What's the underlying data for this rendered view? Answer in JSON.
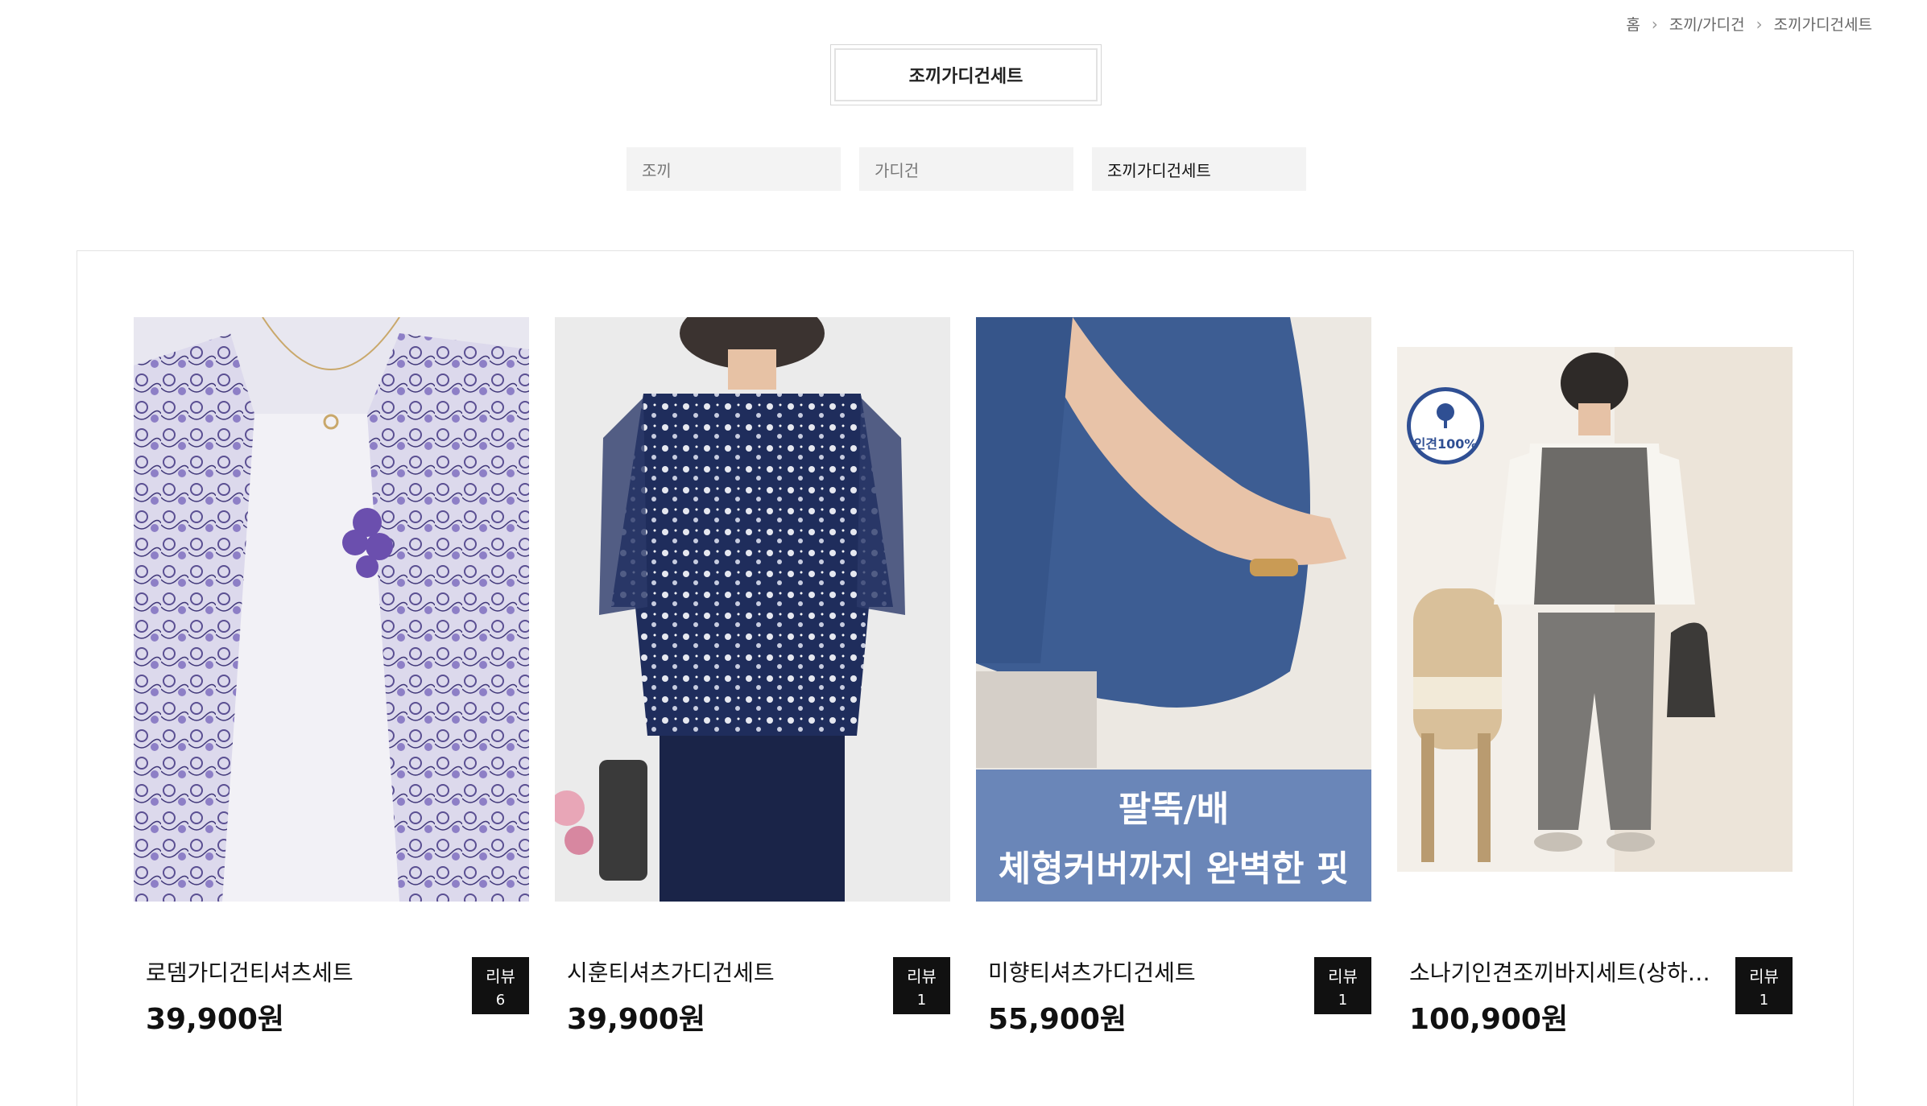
{
  "breadcrumb": [
    "홈",
    "조끼/가디건",
    "조끼가디건세트"
  ],
  "category_title": "조끼가디건세트",
  "subcategories": [
    {
      "label": "조끼",
      "active": false
    },
    {
      "label": "가디건",
      "active": false
    },
    {
      "label": "조끼가디건세트",
      "active": true
    }
  ],
  "products": [
    {
      "name": "로뎀가디건티셔츠세트",
      "price": "39,900원",
      "review_label": "리뷰",
      "review_count": "6"
    },
    {
      "name": "시훈티셔츠가디건세트",
      "price": "39,900원",
      "review_label": "리뷰",
      "review_count": "1"
    },
    {
      "name": "미향티셔츠가디건세트",
      "price": "55,900원",
      "review_label": "리뷰",
      "review_count": "1",
      "image_text": [
        "팔뚝/배",
        "체형커버까지 완벽한 핏"
      ]
    },
    {
      "name": "소나기인견조끼바지세트(상하…",
      "price": "100,900원",
      "review_label": "리뷰",
      "review_count": "1",
      "badge_text": "인견100%"
    }
  ],
  "colors": {
    "review_badge_bg": "#111111",
    "image_banner": "#6a86b8",
    "badge_ring": "#2f4f93"
  }
}
